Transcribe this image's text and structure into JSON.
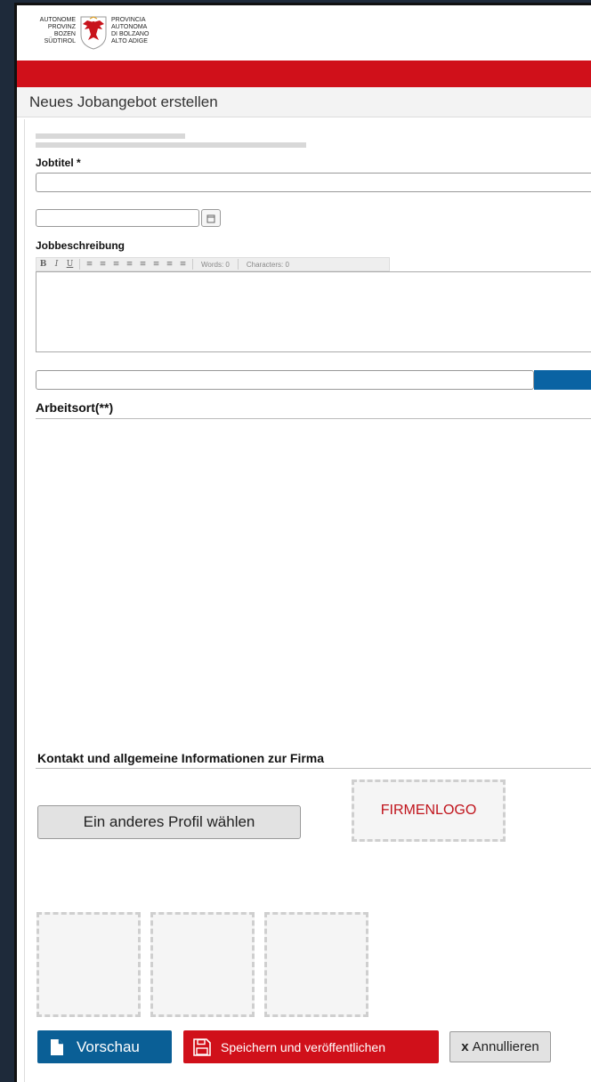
{
  "header": {
    "logo_left_lines": [
      "AUTONOME",
      "PROVINZ",
      "BOZEN",
      "SÜDTIROL"
    ],
    "logo_right_lines": [
      "PROVINCIA",
      "AUTONOMA",
      "DI BOLZANO",
      "ALTO ADIGE"
    ],
    "brand_color": "#d0101a"
  },
  "page": {
    "title": "Neues Jobangebot erstellen"
  },
  "form": {
    "jobtitel_label": "Jobtitel *",
    "jobtitel_value": "",
    "date_value": "",
    "date_icon": "calendar-icon",
    "beschreibung_label": "Jobbeschreibung",
    "toolbar": {
      "buttons": [
        "B",
        "I",
        "U",
        "≡",
        "≡",
        "≡",
        "≡",
        "≡",
        "≡",
        "≡",
        "≡"
      ],
      "words": "Words: 0",
      "characters": "Characters: 0"
    },
    "search_value": "",
    "arbeitsort_label": "Arbeitsort(**)",
    "kontakt_label": "Kontakt und allgemeine Informationen zur Firma",
    "profil_button": "Ein anderes Profil wählen",
    "firmenlogo": "FIRMENLOGO"
  },
  "footer": {
    "vorschau": "Vorschau",
    "speichern": "Speichern und veröffentlichen",
    "annullieren_x": "x",
    "annullieren": "Annullieren",
    "colors": {
      "vorschau": "#0a5f96",
      "speichern": "#d0101a"
    }
  }
}
